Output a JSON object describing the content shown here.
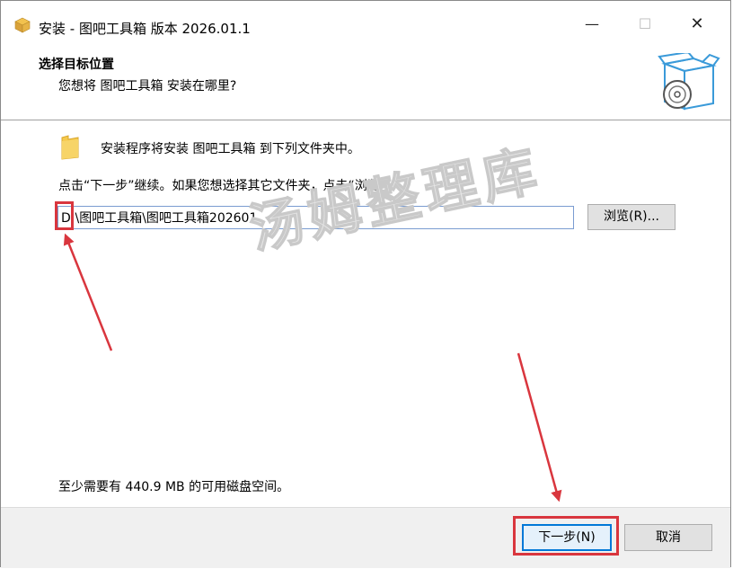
{
  "window": {
    "title": "安装 - 图吧工具箱 版本 2026.01.1",
    "minimize_glyph": "—",
    "maximize_glyph": "☐",
    "close_glyph": "✕"
  },
  "header": {
    "title": "选择目标位置",
    "subtitle": "您想将 图吧工具箱 安装在哪里?"
  },
  "body": {
    "intro": "安装程序将安装 图吧工具箱 到下列文件夹中。",
    "instruction": "点击“下一步”继续。如果您想选择其它文件夹，点击“浏览”。",
    "path_value": "D:\\图吧工具箱\\图吧工具箱202601",
    "browse_label": "浏览(R)...",
    "space_required": "至少需要有 440.9 MB 的可用磁盘空间。"
  },
  "footer": {
    "next_label": "下一步(N)",
    "cancel_label": "取消"
  },
  "watermark": "汤姆整理库",
  "icons": {
    "app": "package-icon",
    "header": "box-with-disc-icon",
    "folder": "folder-icon"
  },
  "colors": {
    "accent": "#0078d7",
    "annotation": "#d9363e",
    "footer_bg": "#f0f0f0",
    "folder": "#f5c94c"
  }
}
